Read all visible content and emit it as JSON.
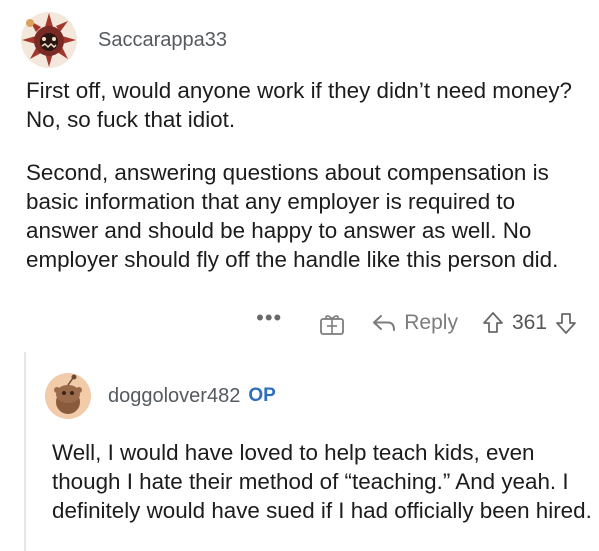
{
  "comment": {
    "username": "Saccarappa33",
    "paragraphs": [
      "First off, would anyone work if they didn’t need money? No, so fuck that idiot.",
      "Second, answering questions about compensation is basic information that any employer is required to answer and should be happy to answer as well. No employer should fly off the handle like this person did."
    ],
    "actions": {
      "more_label": "•••",
      "reply_label": "Reply",
      "vote_count": "361"
    }
  },
  "reply_comment": {
    "username": "doggolover482",
    "badge": "OP",
    "text": "Well, I would have loved to help teach kids, even though I hate their method of “teaching.” And yeah. I definitely would have sued if I had officially been hired."
  },
  "colors": {
    "muted": "#7c7c7c",
    "op_badge": "#2f6fbd",
    "thread_line": "#e4e6e8"
  },
  "icons": [
    "avatar-demon",
    "gift-icon",
    "reply-arrow-icon",
    "upvote-icon",
    "downvote-icon",
    "avatar-snoo"
  ]
}
